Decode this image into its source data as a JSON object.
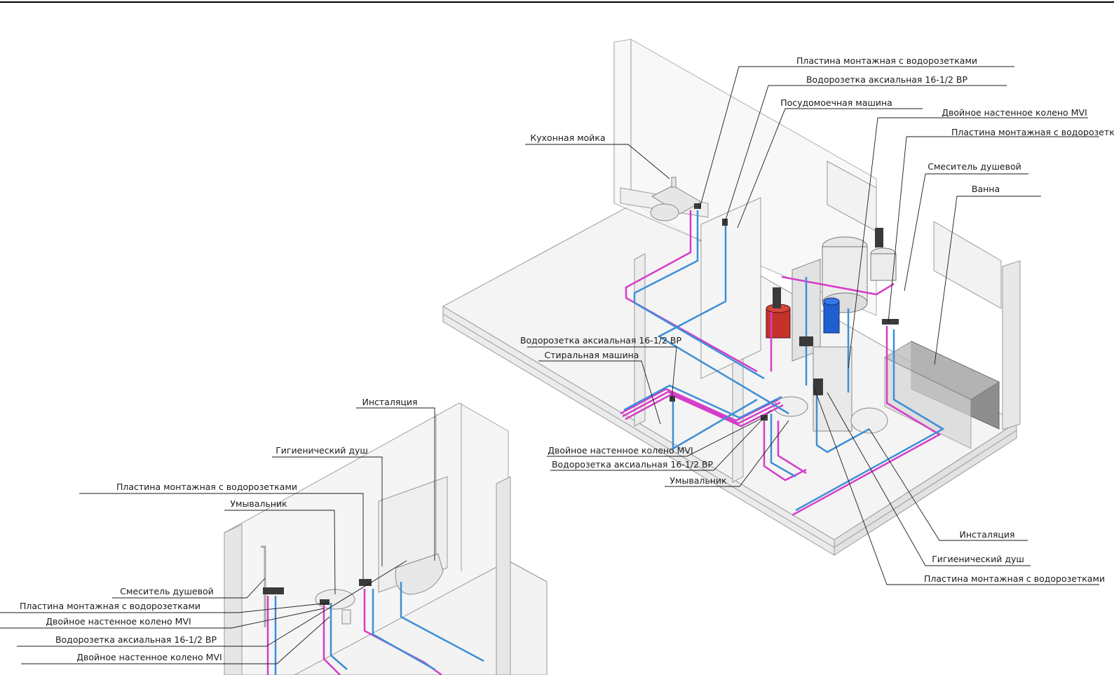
{
  "diagram": {
    "colors": {
      "hot_pipe": "#d63cc8",
      "cold_pipe": "#3d8fd6",
      "leader": "#1a1a1a",
      "structure": "#9a9a9a",
      "equipment_blue": "#1f5fd0",
      "equipment_red": "#c4322a",
      "equipment_dark": "#3a3a3a"
    },
    "labels": [
      "Пластина монтажная с водорозетками",
      "Водорозетка аксиальная 16-1/2 ВР",
      "Посудомоечная машина",
      "Двойное настенное колено MVI",
      "Пластина монтажная с водорозетк",
      "Кухонная мойка",
      "Смеситель душевой",
      "Ванна",
      "Водорозетка аксиальная 16-1/2 ВР",
      "Стиральная машина",
      "Двойное настенное колено MVI",
      "Водорозетка аксиальная 16-1/2 ВР",
      "Умывальник",
      "Инсталяция",
      "Гигиенический душ",
      "Пластина монтажная с водорозетками",
      "Инсталяция",
      "Гигиенический душ",
      "Пластина монтажная с водорозетками",
      "Умывальник",
      "Смеситель душевой",
      "Пластина монтажная с водорозетками",
      "Двойное настенное колено MVI",
      "Водорозетка аксиальная 16-1/2 ВР",
      "Двойное настенное колено MVI"
    ]
  }
}
